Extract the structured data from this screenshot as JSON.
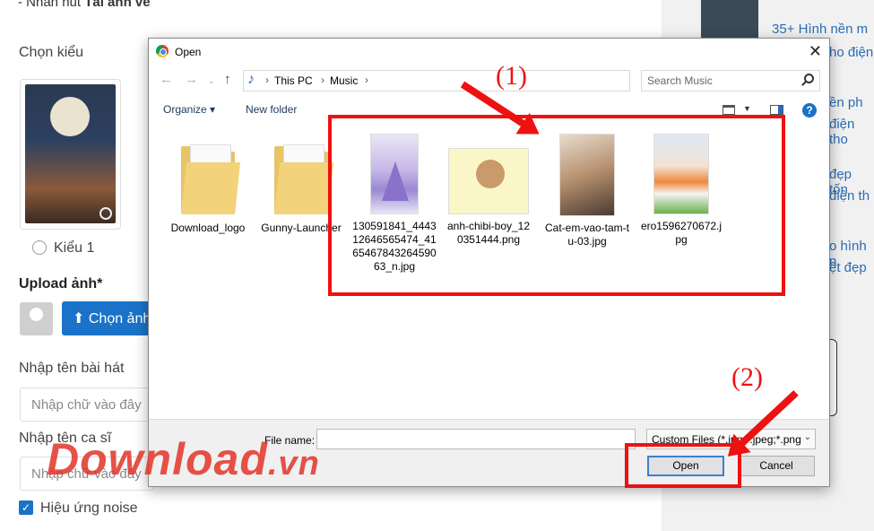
{
  "background": {
    "top_note_prefix": "- Nhấn nút ",
    "top_note_bold": "Tải ảnh về",
    "choose_style_label": "Chọn kiểu",
    "style_option_label": "Kiểu 1",
    "upload_label": "Upload ảnh*",
    "upload_button": "Chọn ảnh",
    "song_name_label": "Nhập tên bài hát",
    "song_name_placeholder": "Nhập chữ vào đây",
    "singer_label": "Nhập tên ca sĩ",
    "singer_placeholder": "Nhập chữ vào đây",
    "noise_label": "Hiệu ứng noise",
    "side_links": [
      "35+ Hình nền m",
      "ho điện",
      "ền ph",
      "điện tho",
      "đẹp tốn",
      "điện th",
      "o hình n",
      "ệt đẹp"
    ]
  },
  "dialog": {
    "title": "Open",
    "close_glyph": "✕",
    "breadcrumbs": [
      "This PC",
      "Music"
    ],
    "search_placeholder": "Search Music",
    "organize_label": "Organize",
    "new_folder_label": "New folder",
    "help_glyph": "?",
    "folders": [
      {
        "label": "Download_logo"
      },
      {
        "label": "Gunny-Launcher"
      }
    ],
    "files": [
      {
        "label": "130591841_444312646565474_416546784326459063_n.jpg",
        "thumb": "tree"
      },
      {
        "label": "anh-chibi-boy_120351444.png",
        "thumb": "chibi"
      },
      {
        "label": "Cat-em-vao-tam-tu-03.jpg",
        "thumb": "couple"
      },
      {
        "label": "ero1596270672.jpg",
        "thumb": "player"
      }
    ],
    "file_name_label": "File name:",
    "file_name_value": "",
    "file_type_value": "Custom Files (*.jpg;*.jpeg;*.png",
    "open_button": "Open",
    "cancel_button": "Cancel"
  },
  "annotations": {
    "step1": "(1)",
    "step2": "(2)",
    "color": "#e11111"
  },
  "watermark": {
    "main": "Download",
    "ext": ".vn"
  }
}
